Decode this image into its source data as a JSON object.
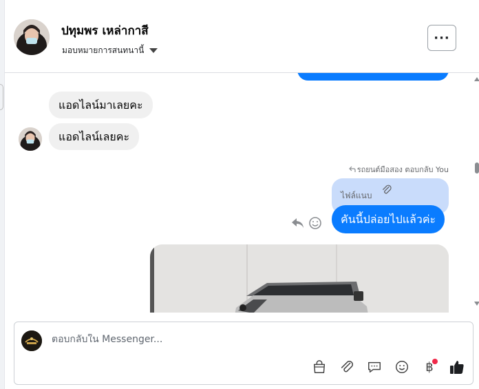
{
  "header": {
    "contact_name": "ปทุมพร เหล่ากาสี",
    "assign_label": "มอบหมายการสนทนานี้",
    "more_label": "···"
  },
  "messages": {
    "incoming": [
      {
        "text": "แอดไลน์มาเลยคะ"
      },
      {
        "text": "แอดไลน์เลยคะ"
      }
    ],
    "reply_context": {
      "label": "รถยนต์มือสอง ตอบกลับ You",
      "quoted_text": "ไฟล์แนบ"
    },
    "outgoing": {
      "text": "คันนี้ปล่อยไปแล้วค่ะ"
    }
  },
  "composer": {
    "placeholder": "ตอบกลับใน Messenger...",
    "payment_symbol": "฿"
  },
  "colors": {
    "outgoing_bubble": "#0a7cff",
    "quoted_bubble": "#c9dcfb",
    "incoming_bubble": "#f0f0f0",
    "notification_dot": "#f02849"
  }
}
